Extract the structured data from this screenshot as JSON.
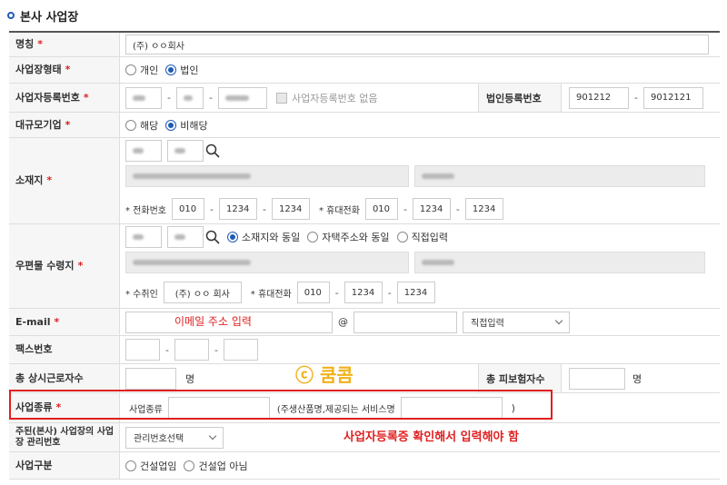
{
  "section": {
    "title": "본사 사업장"
  },
  "fields": {
    "name": {
      "label": "명칭",
      "required_mark": "*",
      "value": "(주) ㅇㅇ회사"
    },
    "biz_type": {
      "label": "사업장형태",
      "required_mark": "*",
      "options": [
        "개인",
        "법인"
      ],
      "selected": "법인"
    },
    "biz_reg_no": {
      "label": "사업자등록번호",
      "required_mark": "*",
      "no_number_label": "사업자등록번호 없음",
      "corp_label": "법인등록번호",
      "corp_part1": "901212",
      "corp_part2": "9012121"
    },
    "large_corp": {
      "label": "대규모기업",
      "required_mark": "*",
      "options": [
        "해당",
        "비해당"
      ],
      "selected": "비해당"
    },
    "location": {
      "label": "소재지",
      "required_mark": "*",
      "phone_label": "* 전화번호",
      "phone": [
        "010",
        "1234",
        "1234"
      ],
      "mobile_label": "* 휴대전화",
      "mobile": [
        "010",
        "1234",
        "1234"
      ]
    },
    "mail_addr": {
      "label": "우편물 수령지",
      "required_mark": "*",
      "options": [
        "소재지와 동일",
        "자택주소와 동일",
        "직접입력"
      ],
      "selected": "소재지와 동일",
      "recipient_label": "* 수취인",
      "recipient": "(주) ㅇㅇ 회사",
      "mobile_label": "* 휴대전화",
      "mobile": [
        "010",
        "1234",
        "1234"
      ]
    },
    "email": {
      "label": "E-mail",
      "required_mark": "*",
      "at": "@",
      "domain_select": "직접입력"
    },
    "fax": {
      "label": "팩스번호"
    },
    "workers": {
      "label": "총 상시근로자수",
      "unit": "명",
      "insured_label": "총 피보험자수",
      "insured_unit": "명"
    },
    "biz_kind": {
      "label": "사업종류",
      "required_mark": "*",
      "kind_label": "사업종류",
      "desc_label": "(주생산품명,제공되는 서비스명",
      "close_paren": ")"
    },
    "main_mgmt": {
      "label": "주된(본사) 사업장의 사업장 관리번호",
      "select": "관리번호선택"
    },
    "construction": {
      "label": "사업구분",
      "options": [
        "건설업임",
        "건설업 아님"
      ],
      "selected": ""
    }
  },
  "annotations": {
    "email_hint": "이메일 주소 입력",
    "watermark": "ⓒ 쿰콤",
    "reg_note": "사업자등록증 확인해서 입력해야 함"
  },
  "colors": {
    "accent": "#1e5bb8",
    "required": "#e02020",
    "watermark": "#f0b21b"
  }
}
